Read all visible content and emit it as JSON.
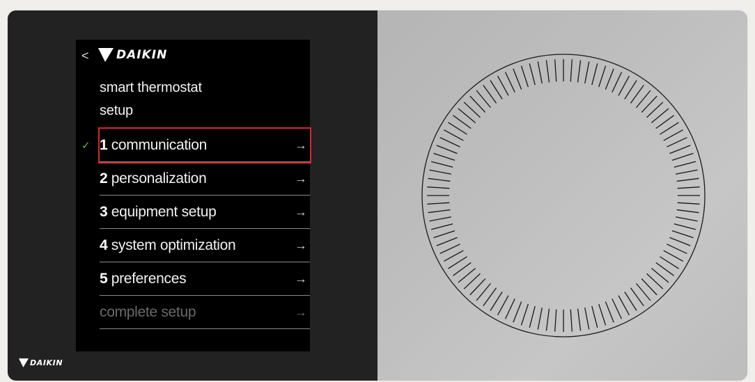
{
  "brand": {
    "name": "DAIKIN",
    "logo_icon": "daikin-triangle-logo",
    "accent_color": "#d9262e",
    "check_color": "#5bbf3a"
  },
  "screen": {
    "back_icon": "chevron-left-icon",
    "title_line1": "smart thermostat",
    "title_line2": "setup",
    "menu": [
      {
        "num": "1",
        "label": "communication",
        "arrow": "→",
        "completed": true,
        "selected": true
      },
      {
        "num": "2",
        "label": "personalization",
        "arrow": "→"
      },
      {
        "num": "3",
        "label": "equipment setup",
        "arrow": "→"
      },
      {
        "num": "4",
        "label": "system optimization",
        "arrow": "→"
      },
      {
        "num": "5",
        "label": "preferences",
        "arrow": "→"
      },
      {
        "num": "",
        "label": "complete setup",
        "arrow": "→",
        "disabled": true
      }
    ],
    "check_glyph": "✓",
    "back_glyph": "<"
  },
  "device": {
    "corner_brand": "DAIKIN",
    "dial_icon": "thermostat-dial-ring",
    "dial_tick_count": 100
  }
}
